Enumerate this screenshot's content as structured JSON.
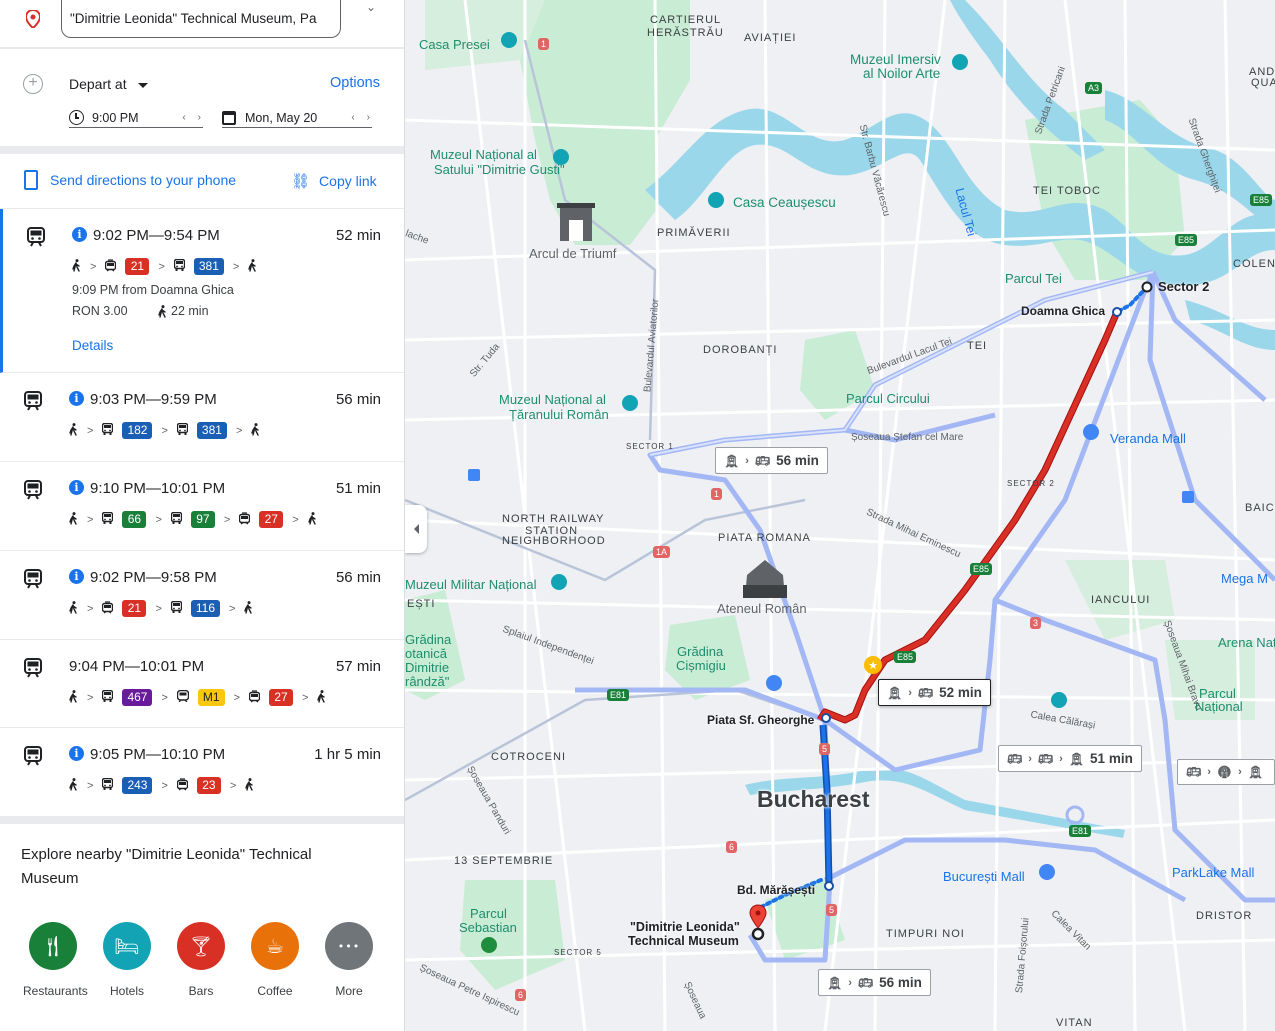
{
  "destination": {
    "value": "\"Dimitrie Leonida\" Technical Museum, Pa"
  },
  "options_row": {
    "depart_label": "Depart at",
    "options_label": "Options",
    "time": "9:00 PM",
    "date": "Mon, May 20"
  },
  "actions": {
    "send": "Send directions to your phone",
    "copy": "Copy link"
  },
  "routes": [
    {
      "time": "9:02 PM—9:54 PM",
      "duration": "52 min",
      "info": true,
      "steps": [
        {
          "label": "21",
          "color": "#d93025",
          "mode": "tram"
        },
        {
          "label": "381",
          "color": "#1a5fb4",
          "mode": "bus"
        }
      ],
      "sub1": "9:09 PM from Doamna Ghica",
      "fare": "RON 3.00",
      "walk": "22 min",
      "details": "Details"
    },
    {
      "time": "9:03 PM—9:59 PM",
      "duration": "56 min",
      "info": true,
      "steps": [
        {
          "label": "182",
          "color": "#1a5fb4",
          "mode": "bus"
        },
        {
          "label": "381",
          "color": "#1a5fb4",
          "mode": "bus"
        }
      ]
    },
    {
      "time": "9:10 PM—10:01 PM",
      "duration": "51 min",
      "info": true,
      "steps": [
        {
          "label": "66",
          "color": "#188038",
          "mode": "bus"
        },
        {
          "label": "97",
          "color": "#188038",
          "mode": "bus"
        },
        {
          "label": "27",
          "color": "#d93025",
          "mode": "tram"
        }
      ]
    },
    {
      "time": "9:02 PM—9:58 PM",
      "duration": "56 min",
      "info": true,
      "steps": [
        {
          "label": "21",
          "color": "#d93025",
          "mode": "tram"
        },
        {
          "label": "116",
          "color": "#1a5fb4",
          "mode": "bus"
        }
      ]
    },
    {
      "time": "9:04 PM—10:01 PM",
      "duration": "57 min",
      "info": false,
      "steps": [
        {
          "label": "467",
          "color": "#6a1b9a",
          "mode": "bus"
        },
        {
          "label": "M1",
          "color": "#f9c80e",
          "mode": "metro"
        },
        {
          "label": "27",
          "color": "#d93025",
          "mode": "tram"
        }
      ]
    },
    {
      "time": "9:05 PM—10:10 PM",
      "duration": "1 hr 5 min",
      "info": true,
      "steps": [
        {
          "label": "243",
          "color": "#1a5fb4",
          "mode": "bus"
        },
        {
          "label": "23",
          "color": "#d93025",
          "mode": "tram"
        }
      ]
    }
  ],
  "explore": {
    "title": "Explore nearby \"Dimitrie Leonida\" Technical Museum",
    "categories": [
      {
        "label": "Restaurants",
        "color": "#188038",
        "icon": "fork-knife-icon"
      },
      {
        "label": "Hotels",
        "color": "#12a4b4",
        "icon": "bed-icon"
      },
      {
        "label": "Bars",
        "color": "#d93025",
        "icon": "cocktail-icon"
      },
      {
        "label": "Coffee",
        "color": "#e8710a",
        "icon": "coffee-icon"
      },
      {
        "label": "More",
        "color": "#70757a",
        "icon": "more-icon"
      }
    ]
  },
  "map": {
    "city": "Bucharest",
    "chips": [
      "56 min",
      "52 min",
      "51 min",
      "56 min"
    ],
    "labels": {
      "cartier": "CARTIERUL",
      "herastrau": "HERĂSTRĂU",
      "aviatiei": "AVIAȚIEI",
      "primaverii": "PRIMĂVERII",
      "dorobanti": "DOROBANȚI",
      "tei": "TEI",
      "tei_toboc": "TEI TOBOC",
      "andronache": "ANDRO",
      "quar": "QUA",
      "colent": "COLENT",
      "baic": "BAIC",
      "north1": "NORTH RAILWAY",
      "north2": "STATION",
      "north3": "NEIGHBORHOOD",
      "piata_romana": "PIATA ROMANA",
      "iancului": "IANCULUI",
      "cotroceni": "COTROCENI",
      "sept13": "13 SEPTEMBRIE",
      "timpuri": "TIMPURI NOI",
      "dristor": "DRISTOR",
      "vitan": "VITAN",
      "esti": "EȘTI",
      "sector1": "SECTOR 1",
      "sector2": "SECTOR 2",
      "sector5": "SECTOR 5"
    },
    "pois": {
      "casa_presei": "Casa Presei",
      "muzeul_imersiv1": "Muzeul Imersiv",
      "muzeul_imersiv2": "al Noilor Arte",
      "muzeul_satului1": "Muzeul Național al",
      "muzeul_satului2": "Satului \"Dimitrie Gusti\"",
      "casa_ceausescu": "Casa Ceaușescu",
      "arcul": "Arcul de Triumf",
      "parcul_tei": "Parcul Tei",
      "taranului1": "Muzeul Național al",
      "taranului2": "Țăranului Român",
      "parcul_circului": "Parcul Circului",
      "veranda": "Veranda Mall",
      "muzeul_militar": "Muzeul Militar Național",
      "ateneul": "Ateneul Român",
      "gradina1": "Grădina",
      "gradina2": "Cișmigiu",
      "botanica1": "Grădina",
      "botanica2": "otanică",
      "botanica3": "Dimitrie",
      "botanica4": "rândză\"",
      "arena1": "Arena Națion",
      "parcul_national1": "Parcul",
      "parcul_national2": "Național",
      "mega": "Mega M",
      "bucuresti_mall": "București Mall",
      "parklake": "ParkLake Mall",
      "sebastian1": "Parcul",
      "sebastian2": "Sebastian"
    },
    "stops": {
      "sector2": "Sector 2",
      "doamna": "Doamna Ghica",
      "piata": "Piata Sf. Gheorghe",
      "maraseti": "Bd. Mărășești",
      "museum1": "\"Dimitrie Leonida\"",
      "museum2": "Technical Museum"
    },
    "streets": {
      "lacul_tei": "Lacul Tei",
      "bd_lacul_tei": "Bulevardul Lacul Tei",
      "stefan": "Șoseaua Ștefan cel Mare",
      "eminescu": "Strada Mihai Eminescu",
      "barbu": "Str. Barbu Văcărescu",
      "aviatorilor": "Bulevardul Aviatorilor",
      "petricani": "Strada Petricani",
      "gherghitei": "Strada Gherghiței",
      "calea_calarasi": "Calea Călărași",
      "independentei": "Splaiul Independenței",
      "mihai_bravu": "Șoseaua Mihai Bravu",
      "panduri": "Șoseaua Panduri",
      "vitan_st": "Calea Vitan",
      "tuda": "Str. Tuda",
      "lache": "lache",
      "foisorului": "Strada Foișorului",
      "petre": "Șoseaua Petre Ispirescu",
      "oltenitei": "Șoseaua"
    },
    "roads": {
      "e85": "E85",
      "e81": "E81",
      "a3": "A3",
      "r1": "1",
      "r1a": "1A",
      "r5": "5",
      "r6": "6",
      "r3": "3"
    }
  }
}
